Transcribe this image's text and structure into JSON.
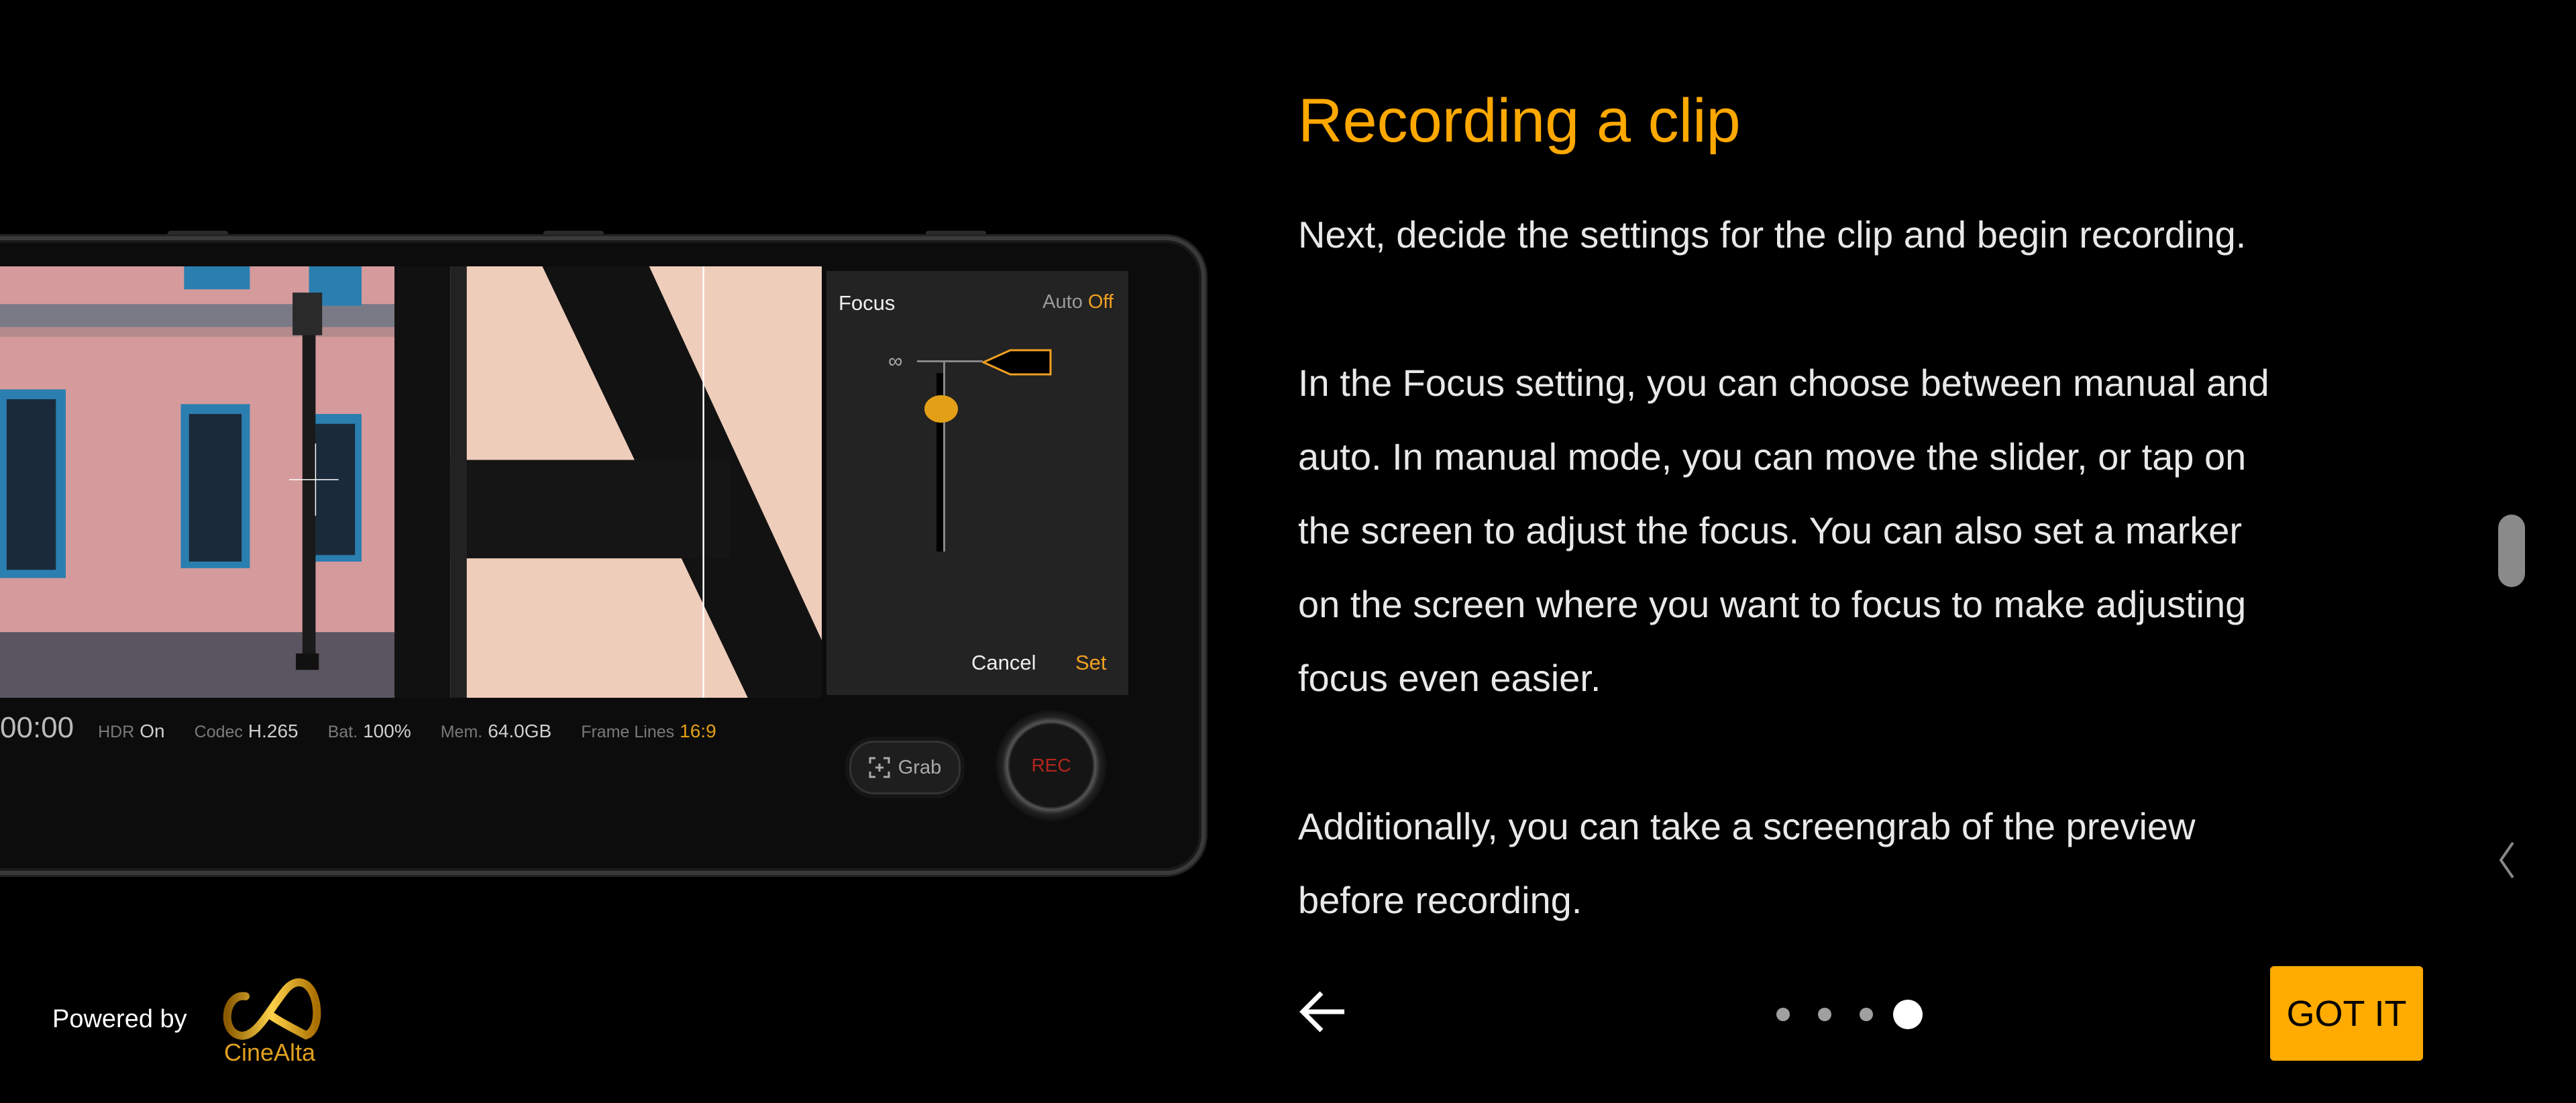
{
  "phone": {
    "focus_panel": {
      "title": "Focus",
      "auto_label": "Auto",
      "auto_value": "Off",
      "infinity_symbol": "∞",
      "cancel_label": "Cancel",
      "set_label": "Set",
      "slider_position_fraction": 0.2
    },
    "status": {
      "timecode": "00:00",
      "hdr_label": "HDR",
      "hdr_value": "On",
      "codec_label": "Codec",
      "codec_value": "H.265",
      "battery_label": "Bat.",
      "battery_value": "100%",
      "memory_label": "Mem.",
      "memory_value": "64.0GB",
      "frame_lines_label": "Frame Lines",
      "frame_lines_value": "16:9"
    },
    "grab_label": "Grab",
    "rec_label": "REC"
  },
  "tutorial": {
    "title": "Recording a clip",
    "paragraphs": [
      [
        "Next, decide the settings for the clip and begin recording."
      ],
      [
        "In the Focus setting, you can choose between manual and",
        "auto. In manual mode, you can move the slider, or tap on",
        "the screen to adjust the focus. You can also set a marker",
        "on the screen where you want to focus to make adjusting",
        "focus even easier."
      ],
      [
        "Additionally, you can take a screengrab of the preview",
        "before recording."
      ]
    ],
    "got_it_label": "GOT IT",
    "page_count": 4,
    "current_page": 4
  },
  "branding": {
    "powered_by": "Powered by",
    "logo_text": "CineAlta"
  },
  "colors": {
    "accent": "#ffab00",
    "title": "#ffa800",
    "background": "#000000"
  }
}
